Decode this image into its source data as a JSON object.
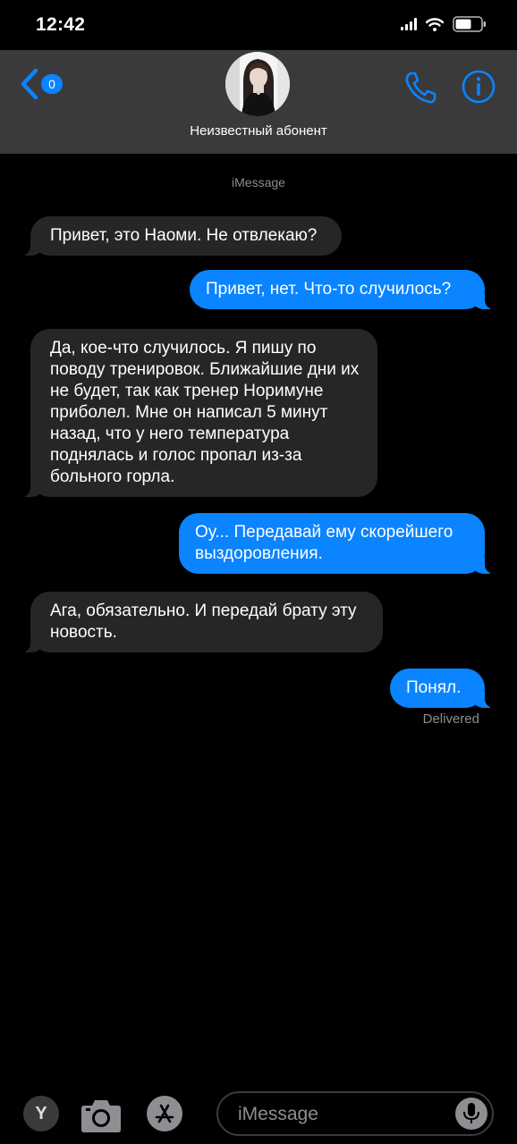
{
  "status_bar": {
    "time": "12:42",
    "icons": [
      "signal-icon",
      "wifi-icon",
      "battery-icon"
    ]
  },
  "header": {
    "back_badge": "0",
    "contact_name": "Неизвестный абонент",
    "icons": [
      "back-chevron-icon",
      "phone-icon",
      "info-icon"
    ],
    "accent_color": "#0a84ff",
    "background": "#3a3a3c"
  },
  "conversation": {
    "service_label": "iMessage",
    "messages": [
      {
        "direction": "incoming",
        "text": "Привет, это Наоми. Не отвлекаю?"
      },
      {
        "direction": "outgoing",
        "text": "Привет, нет. Что-то случилось?"
      },
      {
        "direction": "incoming",
        "text": "Да, кое-что случилось. Я пишу по поводу тренировок. Ближайшие дни их не будет, так как тренер Норимуне приболел. Мне он написал 5 минут назад, что у него температура поднялась и голос пропал из-за больного горла."
      },
      {
        "direction": "outgoing",
        "text": "Оу... Передавай ему скорейшего выздоровления."
      },
      {
        "direction": "incoming",
        "text": "Ага, обязательно. И передай брату эту новость."
      },
      {
        "direction": "outgoing",
        "text": "Понял."
      }
    ],
    "delivered_label": "Delivered",
    "incoming_color": "#262628",
    "outgoing_color": "#0a84ff"
  },
  "input_bar": {
    "placeholder": "iMessage",
    "app_button_label": "Y",
    "icons": [
      "app-drawer-icon",
      "camera-icon",
      "app-store-icon",
      "microphone-icon"
    ]
  }
}
